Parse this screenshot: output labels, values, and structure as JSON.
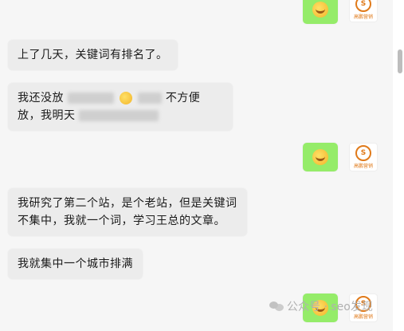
{
  "messages": [
    {
      "text": "上了几天，关键词有排名了。"
    },
    {
      "text_part1": "我还没放",
      "text_part2": "，",
      "text_part3": "不方便",
      "text_line2a": "放，我明天"
    },
    {
      "line1": "我研究了第二个站，是个老站，但是关键词",
      "line2": "不集中，我就一个词，学习王总的文章。"
    },
    {
      "text": "我就集中一个城市排满"
    }
  ],
  "avatar": {
    "label": "S",
    "caption": "高鹏营销"
  },
  "watermark": {
    "text": "公众号 · seo发现"
  }
}
